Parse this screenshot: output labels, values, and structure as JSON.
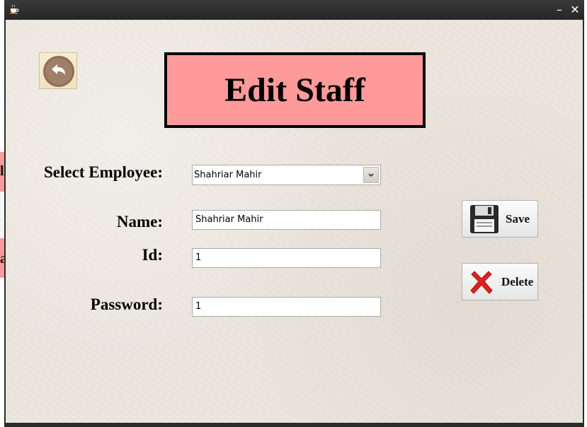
{
  "titlebar": {
    "icon": "coffee-cup-icon",
    "minimize_glyph": "–",
    "close_glyph": "✕"
  },
  "background_window": {
    "glyph_top": "l",
    "glyph_bottom": "a"
  },
  "back_button": {
    "icon": "undo-arrow-icon"
  },
  "page": {
    "title": "Edit Staff"
  },
  "form": {
    "select_employee_label": "Select Employee:",
    "select_employee_value": "Shahriar Mahir",
    "name_label": "Name:",
    "name_value": "Shahriar Mahir",
    "id_label": "Id:",
    "id_value": "1",
    "password_label": "Password:",
    "password_value": "1"
  },
  "actions": {
    "save_label": "Save",
    "save_icon": "floppy-disk-icon",
    "delete_label": "Delete",
    "delete_icon": "red-x-icon"
  },
  "colors": {
    "title_box": "#fe9a9a",
    "titlebar": "#2b2b2b",
    "background": "#ece6de",
    "delete_red": "#e02020"
  }
}
